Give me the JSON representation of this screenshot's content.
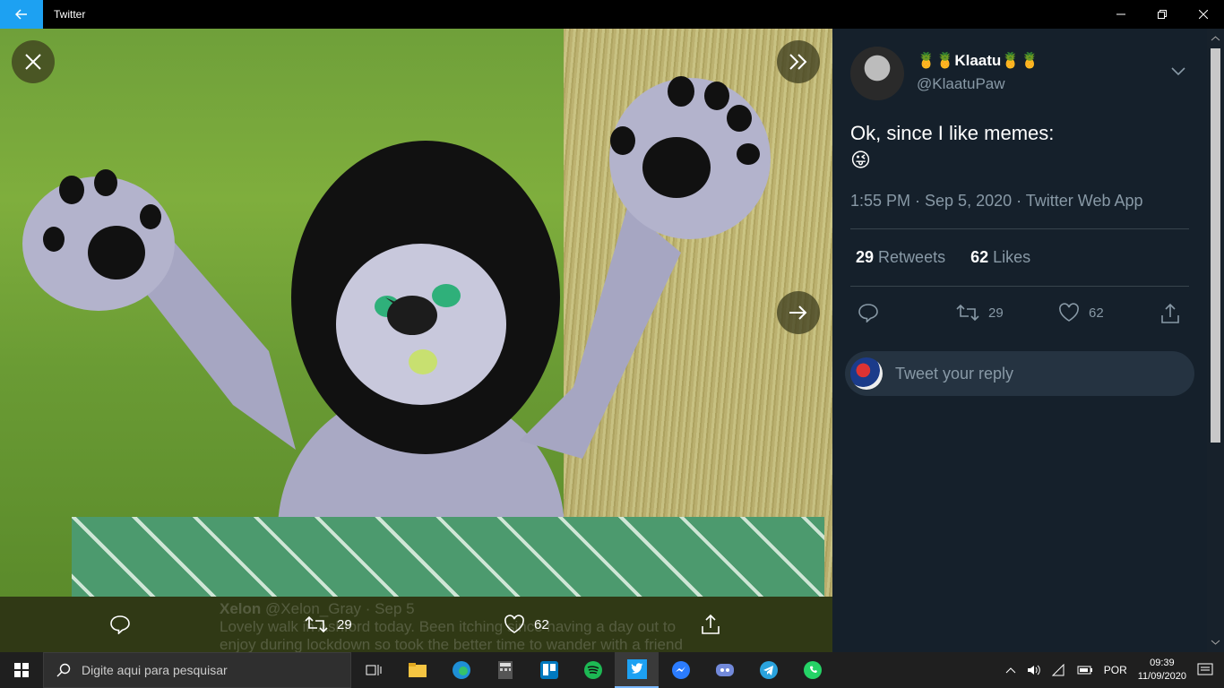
{
  "window": {
    "title": "Twitter",
    "accent": "#1da1f2"
  },
  "media": {
    "actions": {
      "retweets": "29",
      "likes": "62"
    },
    "ghost_text": {
      "name": "Xelon",
      "handle_date": "@Xelon_Gray · Sep 5",
      "line1": "Lovely walk in Ashford today. Been itching since having a day out to",
      "line2": "enjoy during lockdown so took the better time to wander with a friend"
    }
  },
  "tweet": {
    "name_prefix": "🍍🍍",
    "name": "Klaatu",
    "name_suffix": "🍍🍍",
    "handle": "@KlaatuPaw",
    "text": "Ok, since I like memes:",
    "emoji": "😜",
    "meta": "1:55 PM · Sep 5, 2020 · Twitter Web App",
    "retweets_count": "29",
    "retweets_label": "Retweets",
    "likes_count": "62",
    "likes_label": "Likes",
    "action_retweets": "29",
    "action_likes": "62",
    "reply_placeholder": "Tweet your reply"
  },
  "taskbar": {
    "search_placeholder": "Digite aqui para pesquisar",
    "language": "POR",
    "time": "09:39",
    "date": "11/09/2020"
  }
}
